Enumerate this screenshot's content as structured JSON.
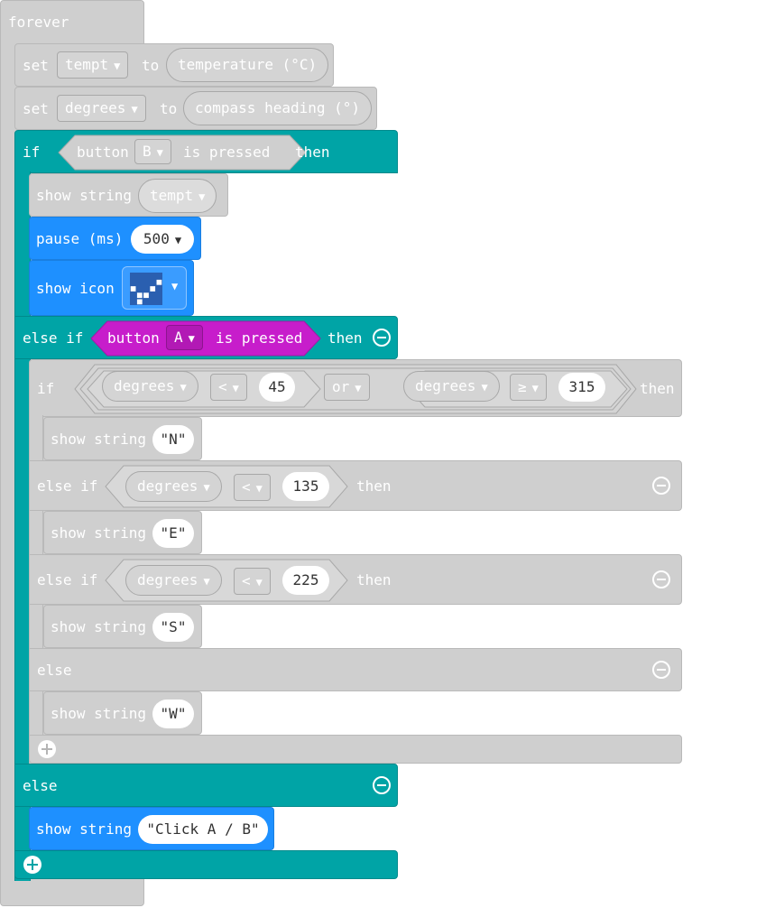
{
  "forever": {
    "label": "forever"
  },
  "set1": {
    "set": "set",
    "var": "tempt",
    "to": "to",
    "value": "temperature (°C)"
  },
  "set2": {
    "set": "set",
    "var": "degrees",
    "to": "to",
    "value": "compass heading (°)"
  },
  "if_main": {
    "if": "if",
    "button": "button",
    "key": "B",
    "is_pressed": "is pressed",
    "then": "then"
  },
  "show_tempt": {
    "label": "show string",
    "value": "tempt"
  },
  "pause": {
    "label": "pause (ms)",
    "value": "500"
  },
  "show_icon": {
    "label": "show icon"
  },
  "elseif_main": {
    "label": "else if",
    "button": "button",
    "key": "A",
    "is_pressed": "is pressed",
    "then": "then"
  },
  "inner_if": {
    "if": "if",
    "var1": "degrees",
    "op1": "<",
    "num1": "45",
    "or": "or",
    "var2": "degrees",
    "op2": "≥",
    "num2": "315",
    "then": "then"
  },
  "show_n": {
    "label": "show string",
    "value": "\"N\""
  },
  "elseif_e": {
    "label": "else if",
    "var": "degrees",
    "op": "<",
    "num": "135",
    "then": "then"
  },
  "show_e": {
    "label": "show string",
    "value": "\"E\""
  },
  "elseif_s": {
    "label": "else if",
    "var": "degrees",
    "op": "<",
    "num": "225",
    "then": "then"
  },
  "show_s": {
    "label": "show string",
    "value": "\"S\""
  },
  "inner_else": {
    "label": "else"
  },
  "show_w": {
    "label": "show string",
    "value": "\"W\""
  },
  "else_main": {
    "label": "else"
  },
  "show_click": {
    "label": "show string",
    "value": "\"Click A / B\""
  },
  "colors": {
    "gray": "#cfcfcf",
    "teal": "#00a4a6",
    "blue": "#1e90ff",
    "magenta": "#c71dcb"
  }
}
